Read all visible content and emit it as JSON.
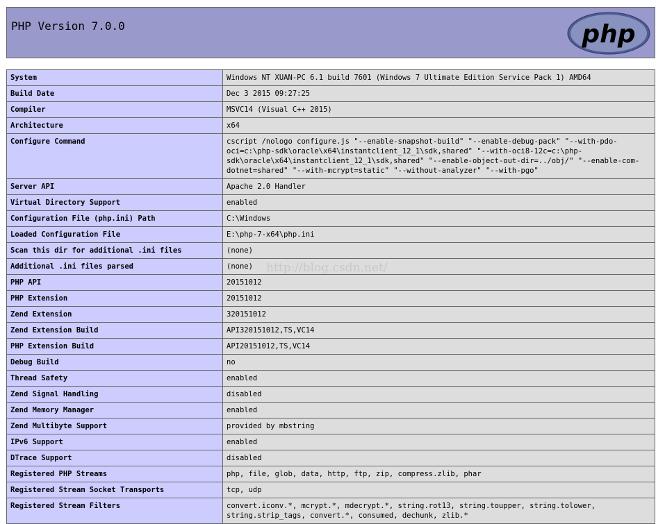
{
  "header": {
    "title": "PHP Version 7.0.0",
    "logo_text": "php"
  },
  "watermark": "http://blog.csdn.net/",
  "rows": [
    {
      "label": "System",
      "value": "Windows NT XUAN-PC 6.1 build 7601 (Windows 7 Ultimate Edition Service Pack 1) AMD64"
    },
    {
      "label": "Build Date",
      "value": "Dec 3 2015 09:27:25"
    },
    {
      "label": "Compiler",
      "value": "MSVC14 (Visual C++ 2015)"
    },
    {
      "label": "Architecture",
      "value": "x64"
    },
    {
      "label": "Configure Command",
      "value": "cscript /nologo configure.js \"--enable-snapshot-build\" \"--enable-debug-pack\" \"--with-pdo-oci=c:\\php-sdk\\oracle\\x64\\instantclient_12_1\\sdk,shared\" \"--with-oci8-12c=c:\\php-sdk\\oracle\\x64\\instantclient_12_1\\sdk,shared\" \"--enable-object-out-dir=../obj/\" \"--enable-com-dotnet=shared\" \"--with-mcrypt=static\" \"--without-analyzer\" \"--with-pgo\""
    },
    {
      "label": "Server API",
      "value": "Apache 2.0 Handler"
    },
    {
      "label": "Virtual Directory Support",
      "value": "enabled"
    },
    {
      "label": "Configuration File (php.ini) Path",
      "value": "C:\\Windows"
    },
    {
      "label": "Loaded Configuration File",
      "value": "E:\\php-7-x64\\php.ini"
    },
    {
      "label": "Scan this dir for additional .ini files",
      "value": "(none)"
    },
    {
      "label": "Additional .ini files parsed",
      "value": "(none)"
    },
    {
      "label": "PHP API",
      "value": "20151012"
    },
    {
      "label": "PHP Extension",
      "value": "20151012"
    },
    {
      "label": "Zend Extension",
      "value": "320151012"
    },
    {
      "label": "Zend Extension Build",
      "value": "API320151012,TS,VC14"
    },
    {
      "label": "PHP Extension Build",
      "value": "API20151012,TS,VC14"
    },
    {
      "label": "Debug Build",
      "value": "no"
    },
    {
      "label": "Thread Safety",
      "value": "enabled"
    },
    {
      "label": "Zend Signal Handling",
      "value": "disabled"
    },
    {
      "label": "Zend Memory Manager",
      "value": "enabled"
    },
    {
      "label": "Zend Multibyte Support",
      "value": "provided by mbstring"
    },
    {
      "label": "IPv6 Support",
      "value": "enabled"
    },
    {
      "label": "DTrace Support",
      "value": "disabled"
    },
    {
      "label": "Registered PHP Streams",
      "value": "php, file, glob, data, http, ftp, zip, compress.zlib, phar"
    },
    {
      "label": "Registered Stream Socket Transports",
      "value": "tcp, udp"
    },
    {
      "label": "Registered Stream Filters",
      "value": "convert.iconv.*, mcrypt.*, mdecrypt.*, string.rot13, string.toupper, string.tolower, string.strip_tags, convert.*, consumed, dechunk, zlib.*"
    }
  ]
}
